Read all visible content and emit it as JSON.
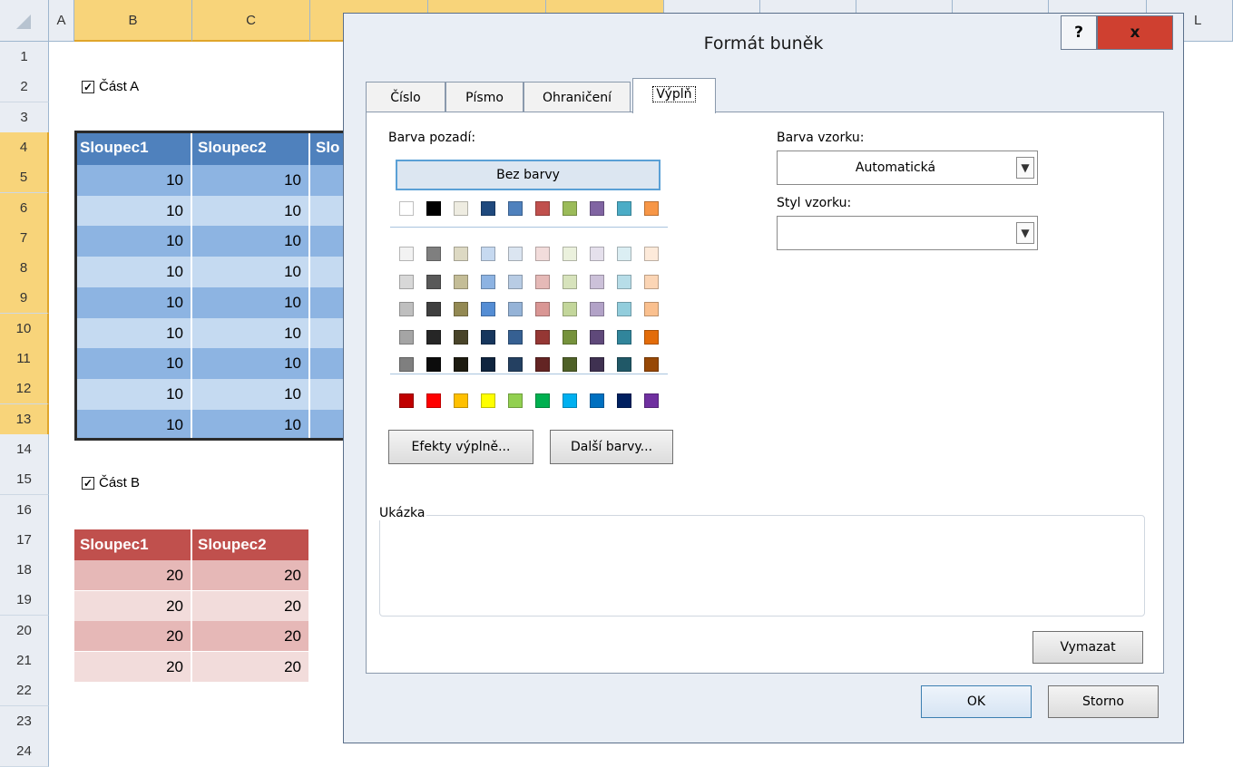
{
  "sheet": {
    "columns": [
      "A",
      "B",
      "C",
      "L"
    ],
    "rows": [
      "1",
      "2",
      "3",
      "4",
      "5",
      "6",
      "7",
      "8",
      "9",
      "10",
      "11",
      "12",
      "13",
      "14",
      "15",
      "16",
      "17",
      "18",
      "19",
      "20",
      "21",
      "22",
      "23",
      "24"
    ],
    "section_a": {
      "label": "Část A",
      "checked": true
    },
    "section_b": {
      "label": "Část B",
      "checked": true
    },
    "table_a": {
      "headers": [
        "Sloupec1",
        "Sloupec2",
        "Slo"
      ],
      "rows": [
        [
          "10",
          "10"
        ],
        [
          "10",
          "10"
        ],
        [
          "10",
          "10"
        ],
        [
          "10",
          "10"
        ],
        [
          "10",
          "10"
        ],
        [
          "10",
          "10"
        ],
        [
          "10",
          "10"
        ],
        [
          "10",
          "10"
        ],
        [
          "10",
          "10"
        ]
      ]
    },
    "table_b": {
      "headers": [
        "Sloupec1",
        "Sloupec2"
      ],
      "rows": [
        [
          "20",
          "20"
        ],
        [
          "20",
          "20"
        ],
        [
          "20",
          "20"
        ],
        [
          "20",
          "20"
        ]
      ]
    }
  },
  "dialog": {
    "title": "Formát buněk",
    "help": "?",
    "close": "x",
    "tabs": [
      "Číslo",
      "Písmo",
      "Ohraničení",
      "Výplň"
    ],
    "active_tab": "Výplň",
    "background_color_label": "Barva pozadí:",
    "no_color": "Bez barvy",
    "theme_colors_row": [
      "#ffffff",
      "#000000",
      "#eeece1",
      "#1f497d",
      "#4f81bd",
      "#c0504d",
      "#9bbb59",
      "#8064a2",
      "#4bacc6",
      "#f79646"
    ],
    "shade_rows": [
      [
        "#f2f2f2",
        "#7f7f7f",
        "#ddd9c3",
        "#c6d9f0",
        "#dbe5f1",
        "#f2dcdb",
        "#ebf1dd",
        "#e5e0ec",
        "#dbeef3",
        "#fdeada"
      ],
      [
        "#d8d8d8",
        "#595959",
        "#c4bd97",
        "#8db3e2",
        "#b8cce4",
        "#e5b9b7",
        "#d7e3bc",
        "#ccc1d9",
        "#b7dde8",
        "#fbd5b5"
      ],
      [
        "#bfbfbf",
        "#3f3f3f",
        "#938953",
        "#548dd4",
        "#95b3d7",
        "#d99694",
        "#c3d69b",
        "#b2a2c7",
        "#92cddc",
        "#fac08f"
      ],
      [
        "#a5a5a5",
        "#262626",
        "#494429",
        "#17365d",
        "#366092",
        "#953734",
        "#76923c",
        "#5f497a",
        "#31859b",
        "#e36c09"
      ],
      [
        "#7f7f7f",
        "#0c0c0c",
        "#1d1b10",
        "#0f243e",
        "#244061",
        "#632423",
        "#4f6128",
        "#3f3151",
        "#205867",
        "#974806"
      ]
    ],
    "standard_colors": [
      "#c00000",
      "#ff0000",
      "#ffc000",
      "#ffff00",
      "#92d050",
      "#00b050",
      "#00b0f0",
      "#0070c0",
      "#002060",
      "#7030a0"
    ],
    "fill_effects_button": "Efekty výplně...",
    "more_colors_button": "Další barvy...",
    "pattern_color_label": "Barva vzorku:",
    "pattern_color_value": "Automatická",
    "pattern_style_label": "Styl vzorku:",
    "pattern_style_value": "",
    "sample_label": "Ukázka",
    "clear_button": "Vymazat",
    "ok_button": "OK",
    "cancel_button": "Storno"
  }
}
